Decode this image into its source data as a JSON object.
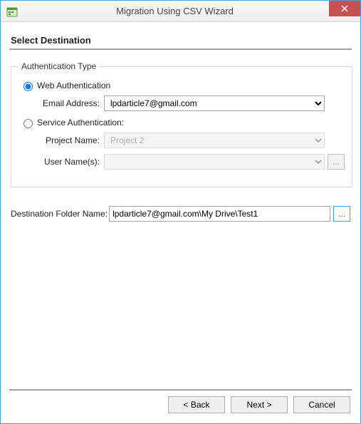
{
  "window": {
    "title": "Migration Using CSV Wizard"
  },
  "page": {
    "heading": "Select Destination"
  },
  "auth": {
    "legend": "Authentication Type",
    "web": {
      "label": "Web Authentication",
      "selected": true,
      "email_label": "Email Address:",
      "email_value": "lpdarticle7@gmail.com"
    },
    "service": {
      "label": "Service Authentication:",
      "selected": false,
      "project_label": "Project Name:",
      "project_value": "Project 2",
      "user_label": "User Name(s):",
      "user_value": ""
    }
  },
  "destination": {
    "label": "Destination Folder Name:",
    "value": "lpdarticle7@gmail.com\\My Drive\\Test1"
  },
  "buttons": {
    "back": "< Back",
    "next": "Next >",
    "cancel": "Cancel",
    "ellipsis": "..."
  }
}
